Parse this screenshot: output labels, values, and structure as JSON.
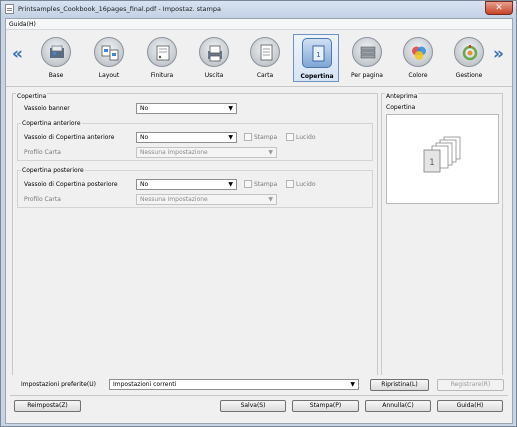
{
  "window": {
    "title": "Printsamples_Cookbook_16pages_final.pdf - Impostaz. stampa",
    "close_glyph": "✕"
  },
  "menu": {
    "guida": "Guida(H)"
  },
  "nav": {
    "left": "«",
    "right": "»"
  },
  "tabs": [
    {
      "label": "Base",
      "icon": "base-icon"
    },
    {
      "label": "Layout",
      "icon": "layout-icon"
    },
    {
      "label": "Finitura",
      "icon": "finishing-icon"
    },
    {
      "label": "Uscita",
      "icon": "output-icon"
    },
    {
      "label": "Carta",
      "icon": "paper-icon"
    },
    {
      "label": "Copertina",
      "icon": "cover-icon",
      "active": true
    },
    {
      "label": "Per pagina",
      "icon": "per-page-icon"
    },
    {
      "label": "Colore",
      "icon": "color-icon"
    },
    {
      "label": "Gestione",
      "icon": "management-icon"
    }
  ],
  "copertina": {
    "title": "Copertina",
    "vassoio_banner_label": "Vassoio banner",
    "vassoio_banner_value": "No",
    "anteriore": {
      "title": "Copertina anteriore",
      "vassoio_label": "Vassoio di Copertina anteriore",
      "vassoio_value": "No",
      "stampa_label": "Stampa",
      "lucido_label": "Lucido",
      "profilo_label": "Profilo Carta",
      "profilo_value": "Nessuna impostazione"
    },
    "posteriore": {
      "title": "Copertina posteriore",
      "vassoio_label": "Vassoio di Copertina posteriore",
      "vassoio_value": "No",
      "stampa_label": "Stampa",
      "lucido_label": "Lucido",
      "profilo_label": "Profilo Carta",
      "profilo_value": "Nessuna impostazione"
    }
  },
  "anteprima": {
    "title": "Anteprima",
    "subtitle": "Copertina"
  },
  "preferite": {
    "label": "Impostazioni preferite(U)",
    "value": "Impostazioni correnti",
    "ripristina": "Ripristina(L)",
    "registra": "Registrare(R)"
  },
  "footer": {
    "reimposta": "Reimposta(Z)",
    "salva": "Salva(S)",
    "stampa": "Stampa(P)",
    "annulla": "Annulla(C)",
    "guida": "Guida(H)"
  },
  "colors": {
    "accent": "#3a70b8",
    "active_tab": "#d6e4f4",
    "close": "#c7422a"
  }
}
